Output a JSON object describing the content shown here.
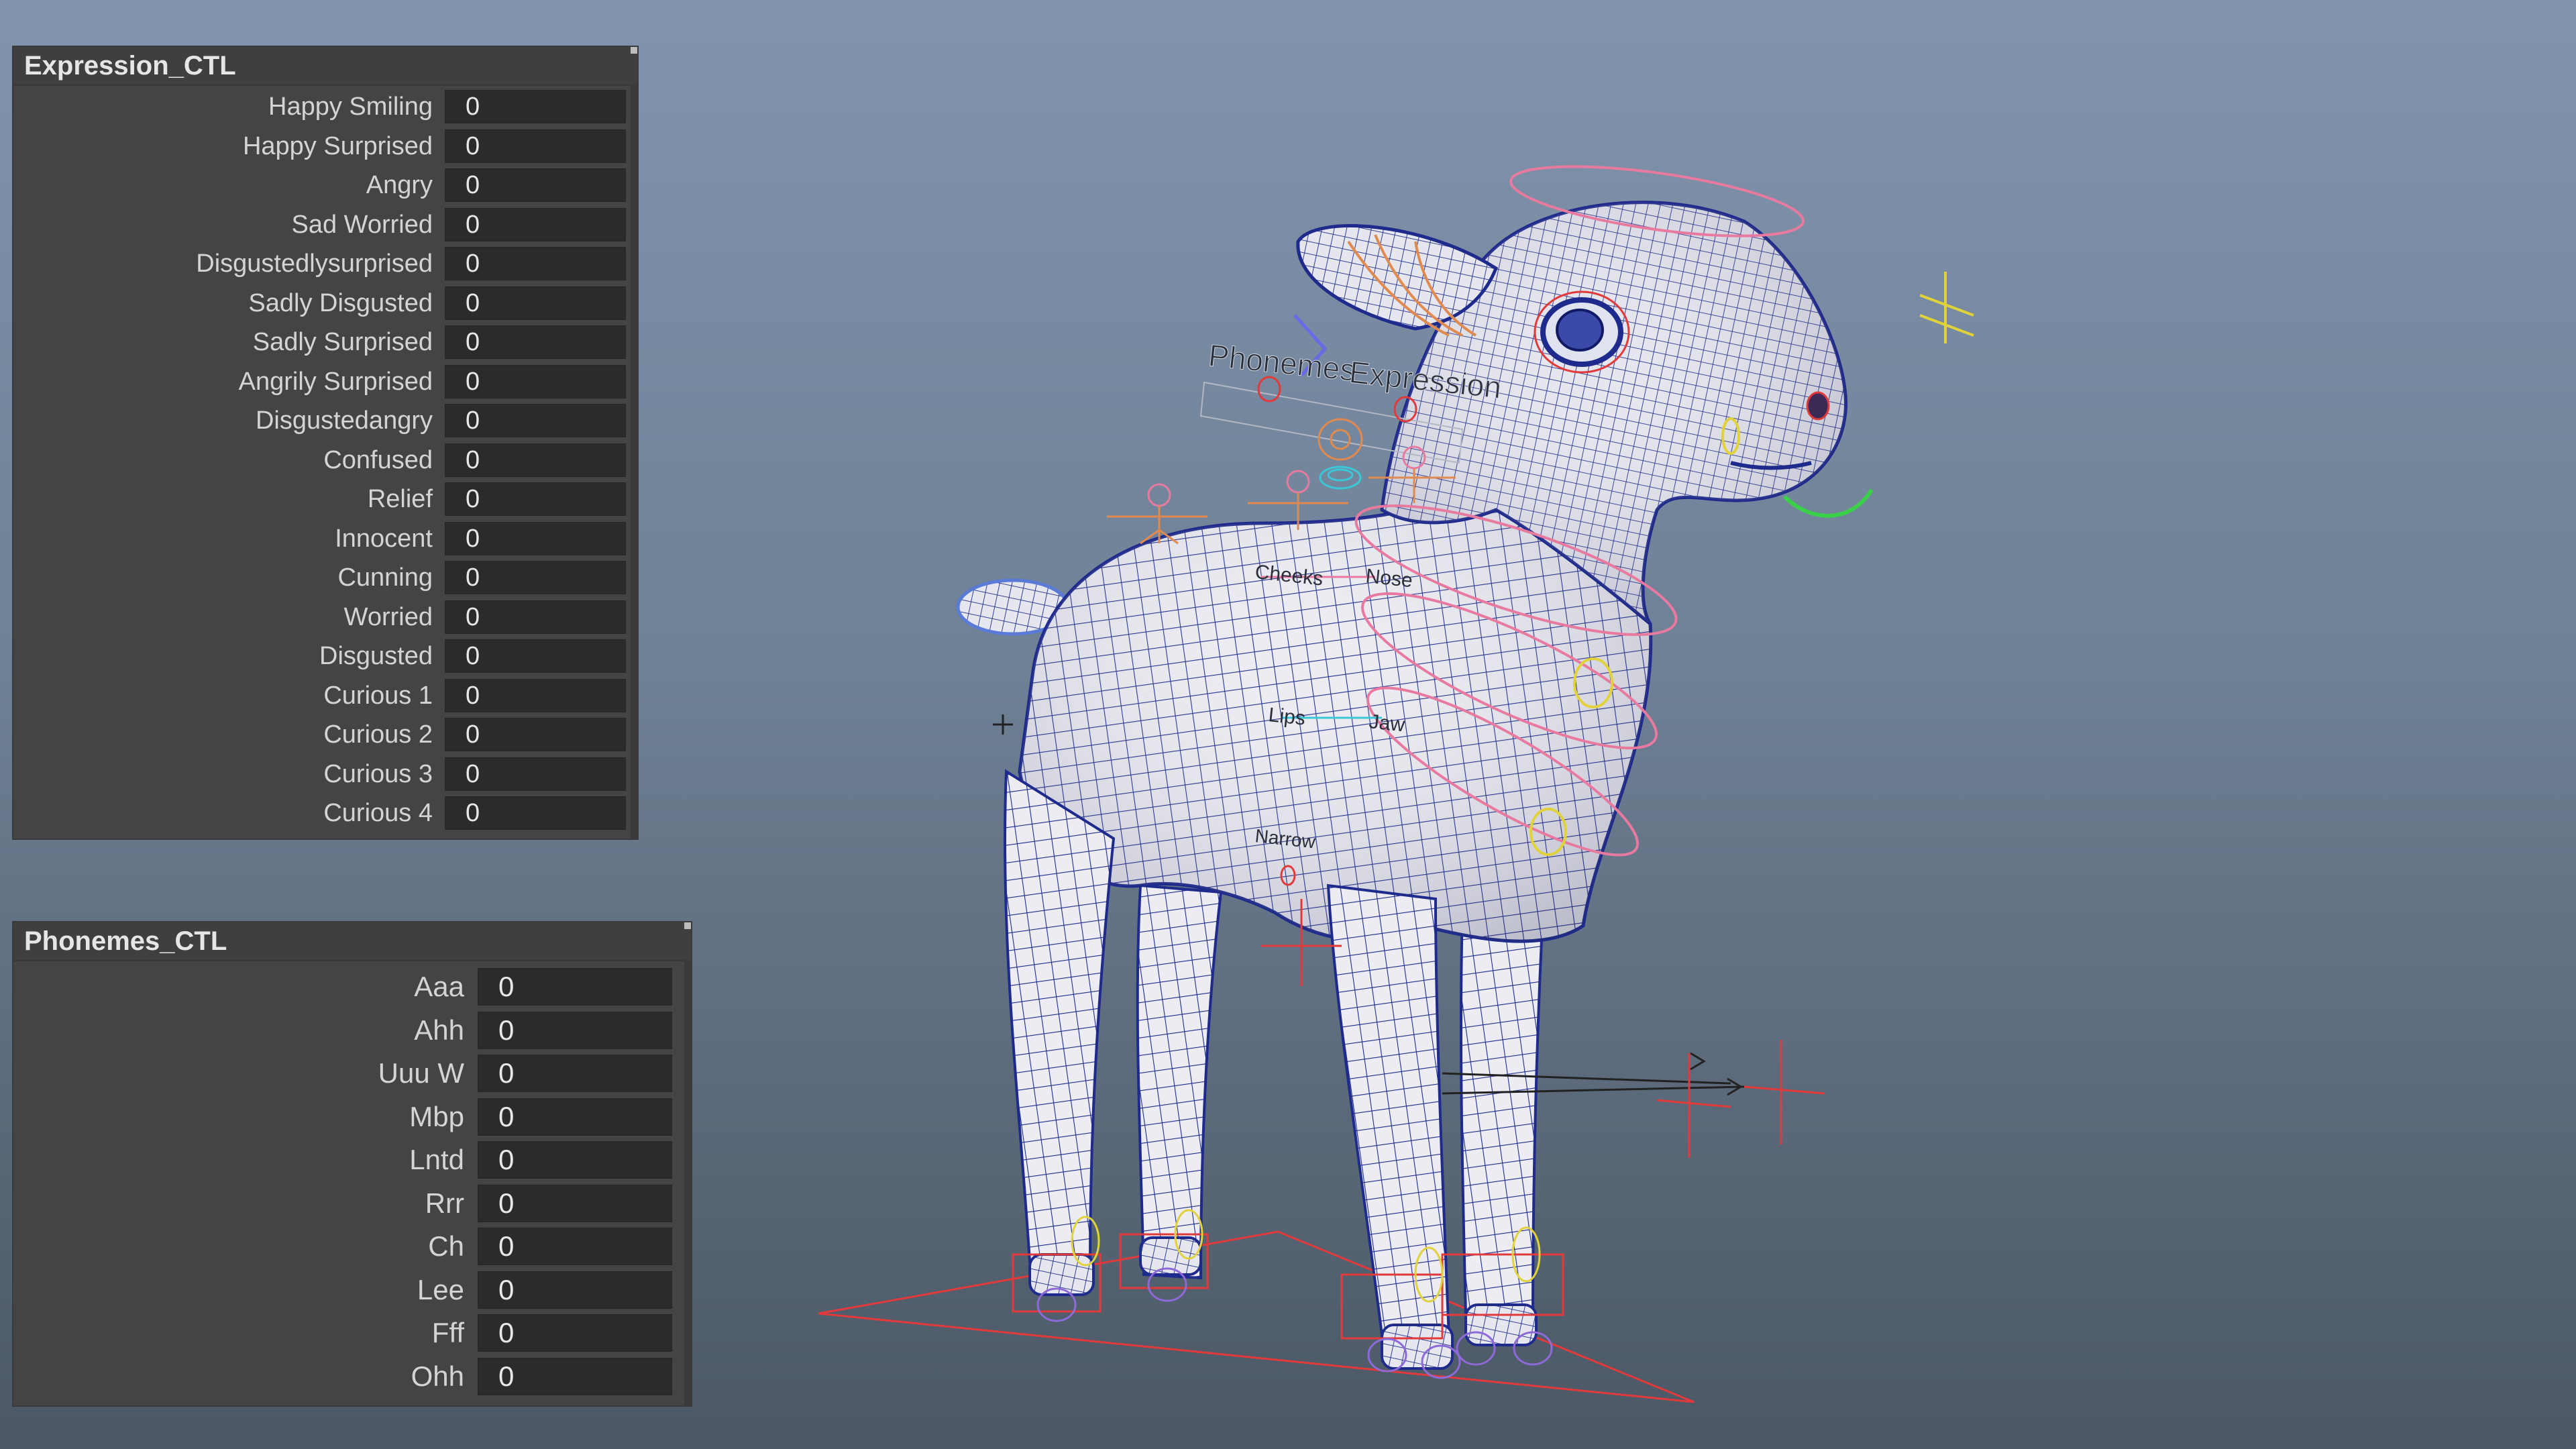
{
  "viewport": {
    "annotations": {
      "phonemes": "Phonemes",
      "expression": "Expression",
      "cheeks": "Cheeks",
      "nose": "Nose",
      "lips": "Lips",
      "jaw": "Jaw",
      "narrow": "Narrow"
    },
    "colors": {
      "mesh_fill": "#e9e9ee",
      "wire": "#1e2a8c",
      "rig_red": "#e23a3a",
      "rig_pink": "#e87aa0",
      "rig_orange": "#e08a50",
      "rig_yellow": "#e2d23a",
      "rig_green": "#3ad04a",
      "rig_cyan": "#3ac8d8"
    }
  },
  "expression_panel": {
    "title": "Expression_CTL",
    "attributes": [
      {
        "label": "Happy Smiling",
        "value": "0"
      },
      {
        "label": "Happy Surprised",
        "value": "0"
      },
      {
        "label": "Angry",
        "value": "0"
      },
      {
        "label": "Sad Worried",
        "value": "0"
      },
      {
        "label": "Disgustedlysurprised",
        "value": "0"
      },
      {
        "label": "Sadly Disgusted",
        "value": "0"
      },
      {
        "label": "Sadly Surprised",
        "value": "0"
      },
      {
        "label": "Angrily Surprised",
        "value": "0"
      },
      {
        "label": "Disgustedangry",
        "value": "0"
      },
      {
        "label": "Confused",
        "value": "0"
      },
      {
        "label": "Relief",
        "value": "0"
      },
      {
        "label": "Innocent",
        "value": "0"
      },
      {
        "label": "Cunning",
        "value": "0"
      },
      {
        "label": "Worried",
        "value": "0"
      },
      {
        "label": "Disgusted",
        "value": "0"
      },
      {
        "label": "Curious 1",
        "value": "0"
      },
      {
        "label": "Curious 2",
        "value": "0"
      },
      {
        "label": "Curious 3",
        "value": "0"
      },
      {
        "label": "Curious 4",
        "value": "0"
      }
    ]
  },
  "phonemes_panel": {
    "title": "Phonemes_CTL",
    "attributes": [
      {
        "label": "Aaa",
        "value": "0"
      },
      {
        "label": "Ahh",
        "value": "0"
      },
      {
        "label": "Uuu W",
        "value": "0"
      },
      {
        "label": "Mbp",
        "value": "0"
      },
      {
        "label": "Lntd",
        "value": "0"
      },
      {
        "label": "Rrr",
        "value": "0"
      },
      {
        "label": "Ch",
        "value": "0"
      },
      {
        "label": "Lee",
        "value": "0"
      },
      {
        "label": "Fff",
        "value": "0"
      },
      {
        "label": "Ohh",
        "value": "0"
      }
    ]
  }
}
